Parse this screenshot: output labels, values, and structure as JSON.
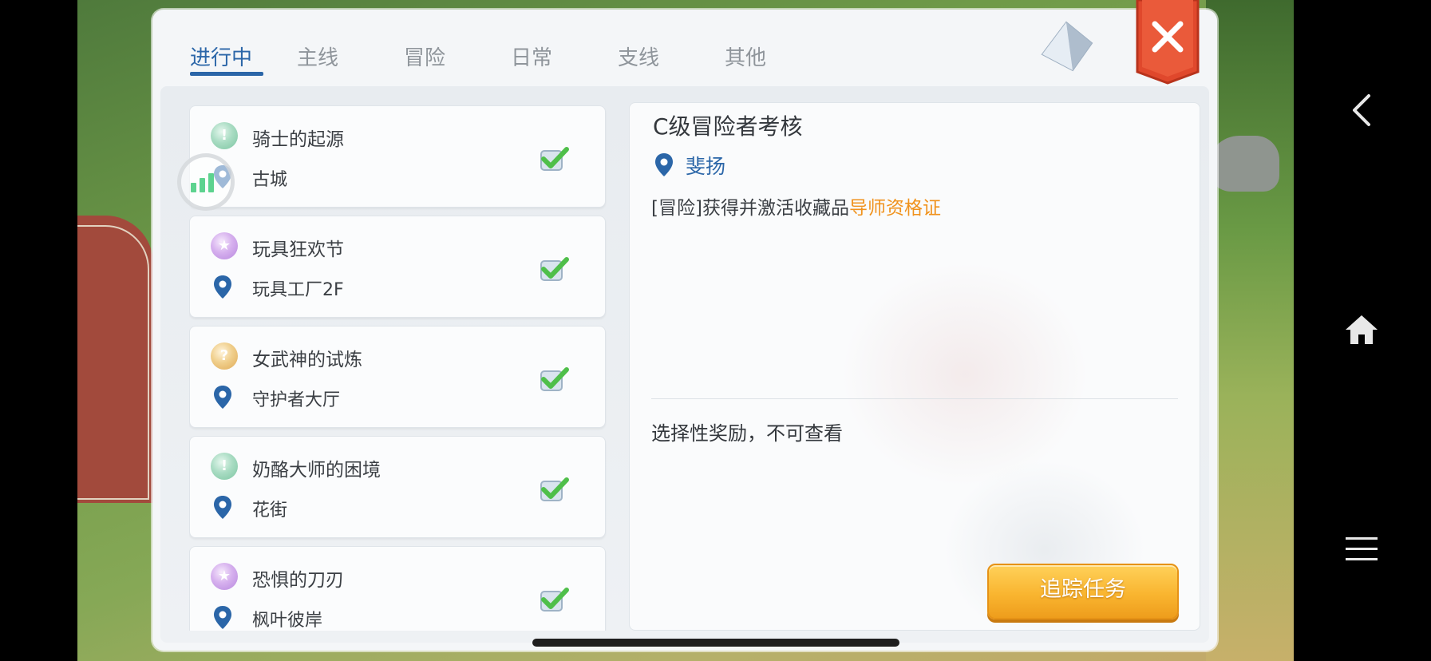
{
  "tabs": [
    {
      "label": "进行中",
      "active": true
    },
    {
      "label": "主线"
    },
    {
      "label": "冒险"
    },
    {
      "label": "日常"
    },
    {
      "label": "支线"
    },
    {
      "label": "其他"
    }
  ],
  "quests": [
    {
      "name": "骑士的起源",
      "location": "古城",
      "icon": "green",
      "completed": true
    },
    {
      "name": "玩具狂欢节",
      "location": "玩具工厂2F",
      "icon": "purple",
      "completed": true
    },
    {
      "name": "女武神的试炼",
      "location": "守护者大厅",
      "icon": "orange",
      "completed": true
    },
    {
      "name": "奶酪大师的困境",
      "location": "花街",
      "icon": "green",
      "completed": true
    },
    {
      "name": "恐惧的刀刃",
      "location": "枫叶彼岸",
      "icon": "purple",
      "completed": true
    }
  ],
  "detail": {
    "title": "C级冒险者考核",
    "npc": "斐扬",
    "desc_prefix": "[冒险]获得并激活收藏品",
    "desc_highlight": "导师资格证",
    "reward_text": "选择性奖励，不可查看",
    "track_button": "追踪任务"
  },
  "colors": {
    "accent_blue": "#2b66a8",
    "highlight_orange": "#f0921c",
    "close_red": "#e0482c",
    "check_green": "#4fbf4a"
  },
  "signal_strength_bars": 3
}
